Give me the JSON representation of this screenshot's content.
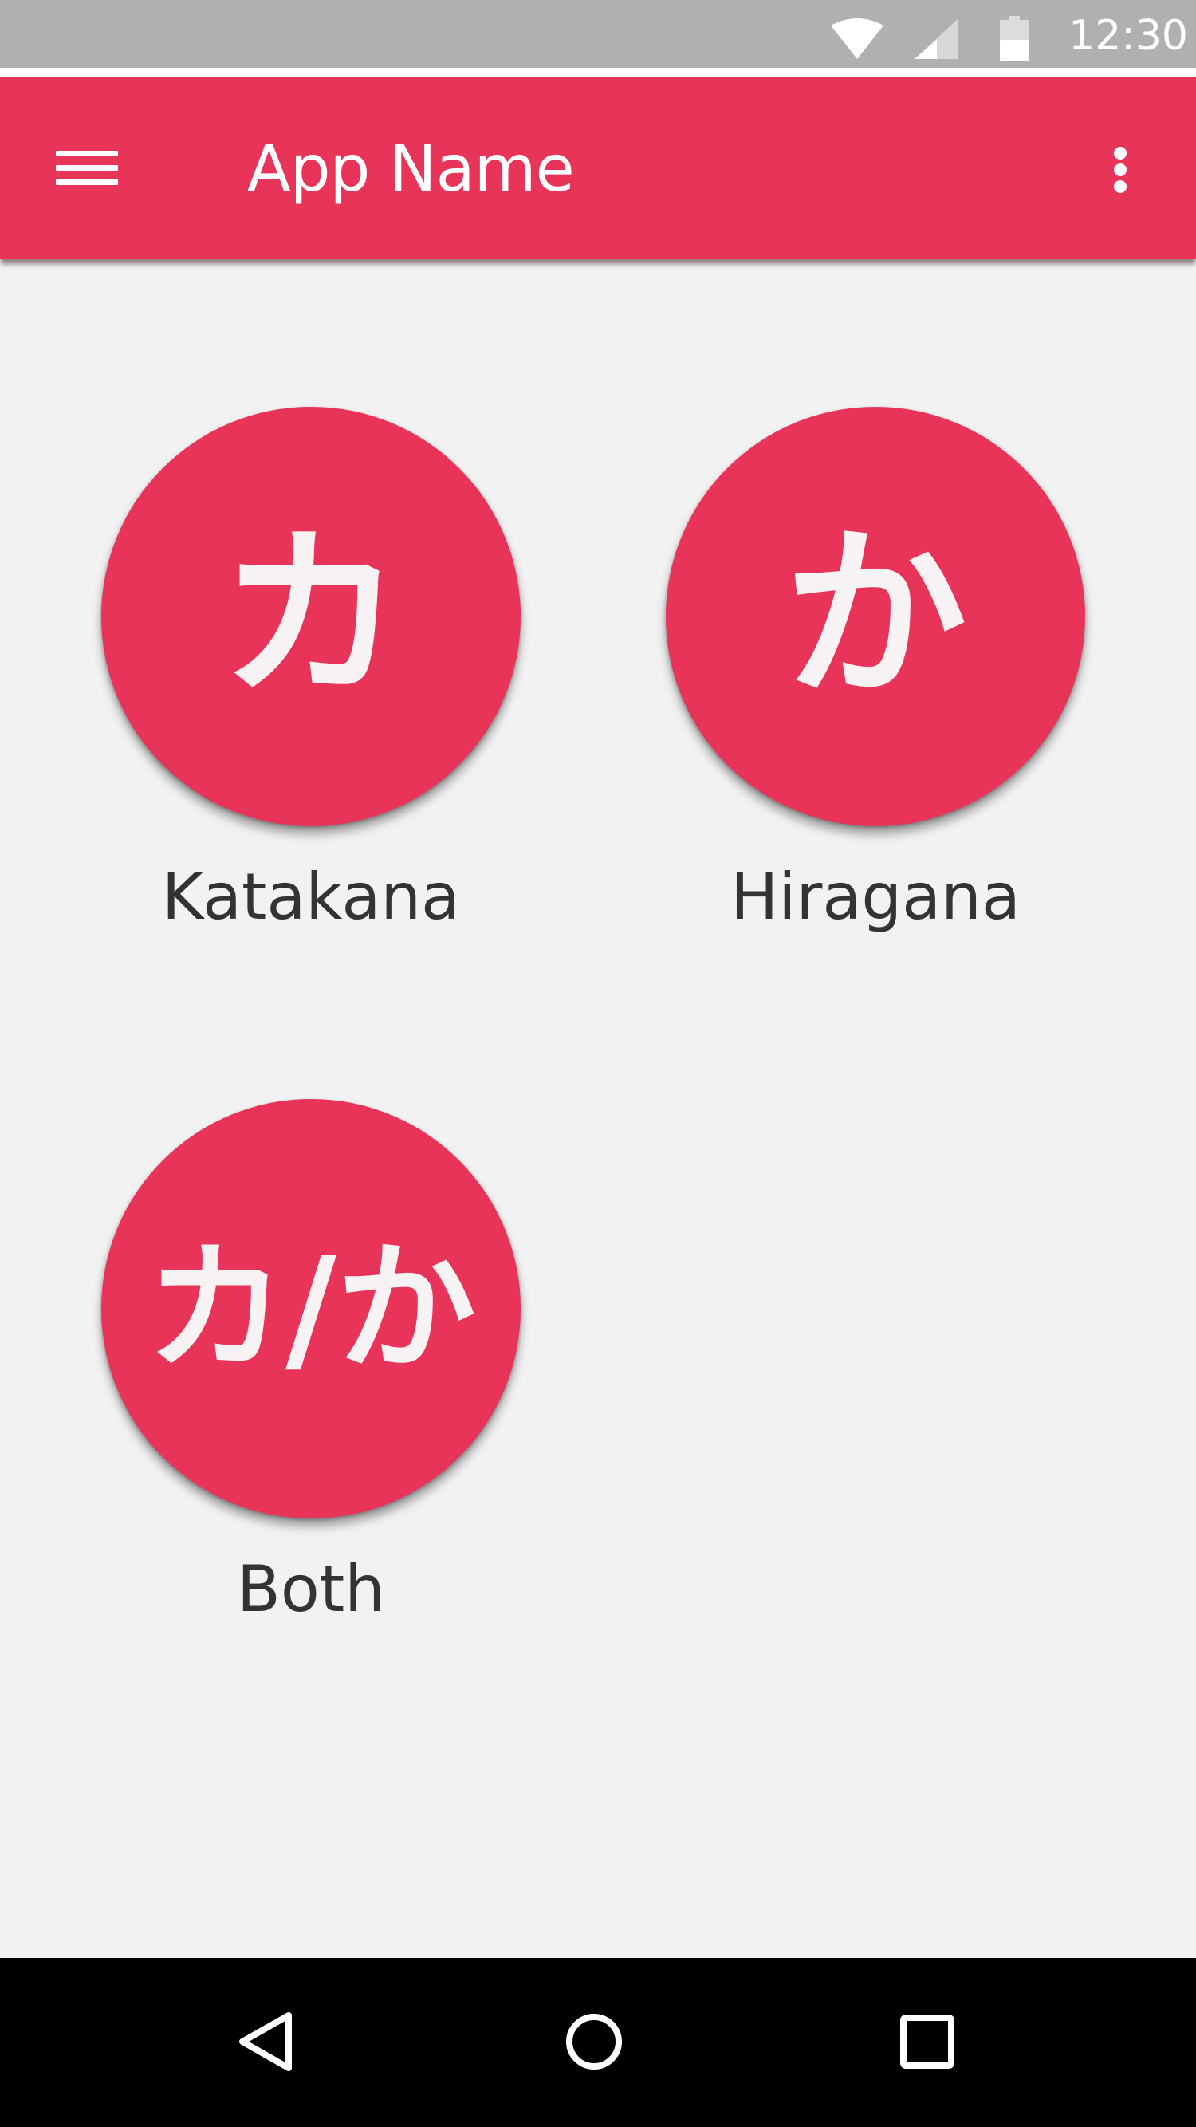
{
  "status_bar": {
    "time": "12:30",
    "icons": [
      "wifi-icon",
      "cellular-signal-icon",
      "battery-icon"
    ]
  },
  "app_bar": {
    "title": "App Name",
    "color": "#e9345a",
    "menu_icon": "hamburger-menu-icon",
    "overflow_icon": "more-vert-icon"
  },
  "options": [
    {
      "glyph": "カ",
      "label": "Katakana"
    },
    {
      "glyph": "か",
      "label": "Hiragana"
    },
    {
      "glyph": "カ/か",
      "label": "Both"
    }
  ],
  "nav_bar": {
    "icons": [
      "back-icon",
      "home-icon",
      "recents-icon"
    ]
  }
}
